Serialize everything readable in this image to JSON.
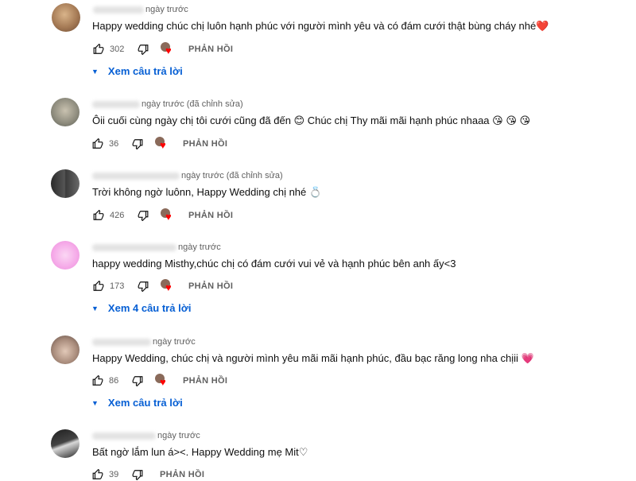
{
  "comments": [
    {
      "timestamp": "ngày trước",
      "text": "Happy wedding chúc chị luôn hạnh phúc với người mình yêu và có đám cưới thật bùng cháy nhé❤️",
      "likes": "302",
      "reply_label": "PHẢN HỒI",
      "view_replies": "Xem câu trả lời"
    },
    {
      "timestamp": "ngày trước (đã chỉnh sửa)",
      "text": "Ôii cuối cùng ngày chị tôi cưới cũng đã đến 😊  Chúc chị Thy mãi mãi hạnh phúc nhaaa 😘 😘 😘",
      "likes": "36",
      "reply_label": "PHẢN HỒI"
    },
    {
      "timestamp": "ngày trước (đã chỉnh sửa)",
      "text": "Trời không ngờ luônn, Happy Wedding chị nhé 💍",
      "likes": "426",
      "reply_label": "PHẢN HỒI"
    },
    {
      "timestamp": "ngày trước",
      "text": "happy wedding Misthy,chúc chị có đám cưới vui vẻ và hạnh phúc bên anh ấy<3",
      "likes": "173",
      "reply_label": "PHẢN HỒI",
      "view_replies": "Xem 4 câu trả lời"
    },
    {
      "timestamp": "ngày trước",
      "text": "Happy Wedding, chúc chị và người mình yêu mãi mãi hạnh phúc, đầu bạc răng long nha chịii 💗",
      "likes": "86",
      "reply_label": "PHẢN HỒI",
      "view_replies": "Xem câu trả lời"
    },
    {
      "timestamp": "ngày trước",
      "text": "Bất ngờ lắm lun á><. Happy Wedding mẹ Mit♡",
      "likes": "39",
      "reply_label": "PHẢN HỒI"
    }
  ],
  "colors": {
    "link": "#065fd4",
    "meta": "#606060",
    "heart": "#ff0000"
  }
}
